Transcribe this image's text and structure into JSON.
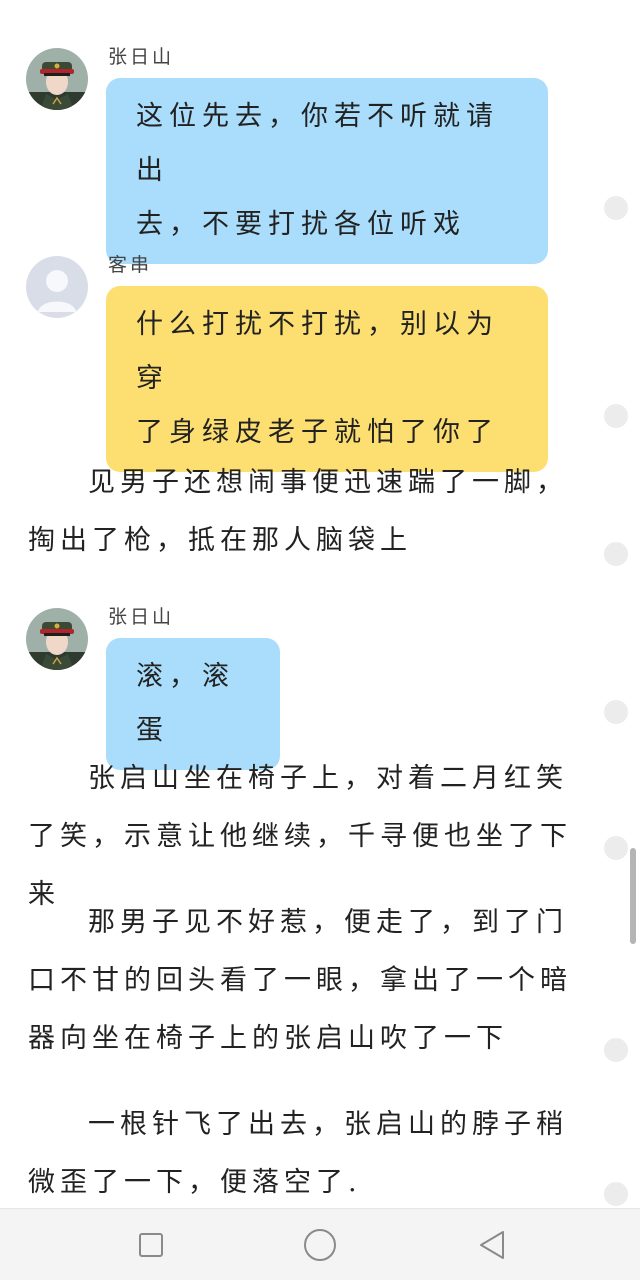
{
  "messages": [
    {
      "speaker": "张日山",
      "avatar": "soldier-avatar",
      "lines": [
        "这位先去，你若不听就请出",
        "去，不要打扰各位听戏"
      ],
      "color": "#a9ddfb"
    },
    {
      "speaker": "客串",
      "avatar": "default-avatar",
      "lines": [
        "什么打扰不打扰，别以为穿",
        "了身绿皮老子就怕了你了"
      ],
      "color": "#fddf71"
    },
    {
      "speaker": "张日山",
      "avatar": "soldier-avatar",
      "lines": [
        "滚，滚蛋"
      ],
      "color": "#a9ddfb"
    }
  ],
  "paragraphs": [
    "见男子还想闹事便迅速踹了一脚，掏出了枪，抵在那人脑袋上",
    "张启山坐在椅子上，对着二月红笑了笑，示意让他继续，千寻便也坐了下来",
    "那男子见不好惹，便走了，到了门口不甘的回头看了一眼，拿出了一个暗器向坐在椅子上的张启山吹了一下",
    "一根针飞了出去，张启山的脖子稍微歪了一下，便落空了."
  ],
  "navbar": {
    "buttons": [
      "recent-apps-icon",
      "home-icon",
      "back-icon"
    ]
  }
}
